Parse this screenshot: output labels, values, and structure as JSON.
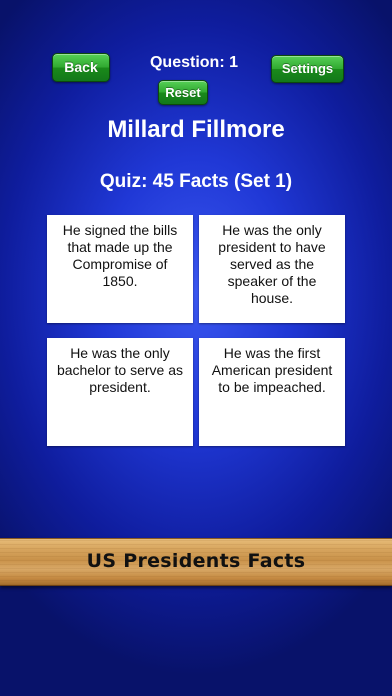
{
  "header": {
    "back_label": "Back",
    "question_label": "Question: 1",
    "settings_label": "Settings",
    "reset_label": "Reset"
  },
  "main": {
    "president_name": "Millard Fillmore",
    "quiz_title": "Quiz: 45 Facts (Set 1)",
    "facts": [
      "He signed the bills that made up the Compromise of 1850.",
      "He was the only president to have served as the speaker of the house.",
      "He was the only bachelor to serve as president.",
      "He was the first American president to be impeached."
    ]
  },
  "footer": {
    "banner_label": "US Presidents Facts"
  },
  "colors": {
    "background": "#2038d6",
    "button_green": "#2fa82f",
    "card_bg": "#ffffff",
    "banner_wood": "#c9924a"
  }
}
